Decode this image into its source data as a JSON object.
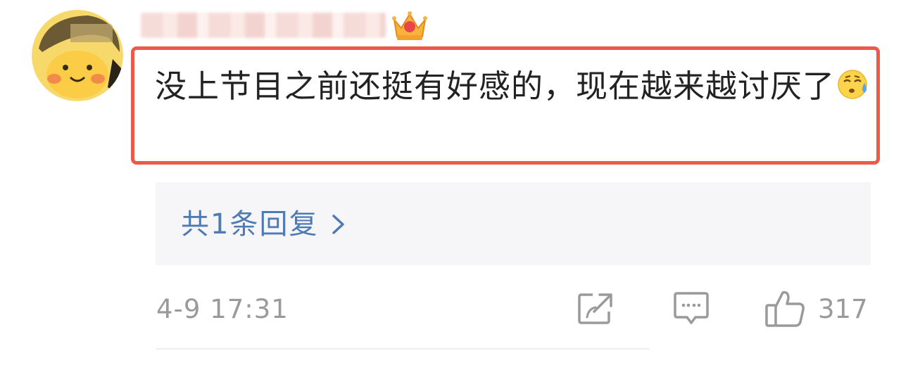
{
  "comment": {
    "text": "没上节目之前还挺有好感的，现在越来越讨厌了",
    "emoji": "sweat-face-emoji"
  },
  "user": {
    "avatar": "cartoon-face-avatar",
    "badge": "crown-badge-icon"
  },
  "replies": {
    "label": "共1条回复"
  },
  "meta": {
    "timestamp": "4-9 17:31",
    "like_count": "317"
  },
  "icons": {
    "share": "share-icon",
    "comment": "comment-icon",
    "like": "thumbs-up-icon"
  },
  "colors": {
    "highlight": "#ee5a49",
    "link": "#4e7bb3",
    "meta_text": "#9a9a9a",
    "reply_bg": "#f6f6f8"
  }
}
